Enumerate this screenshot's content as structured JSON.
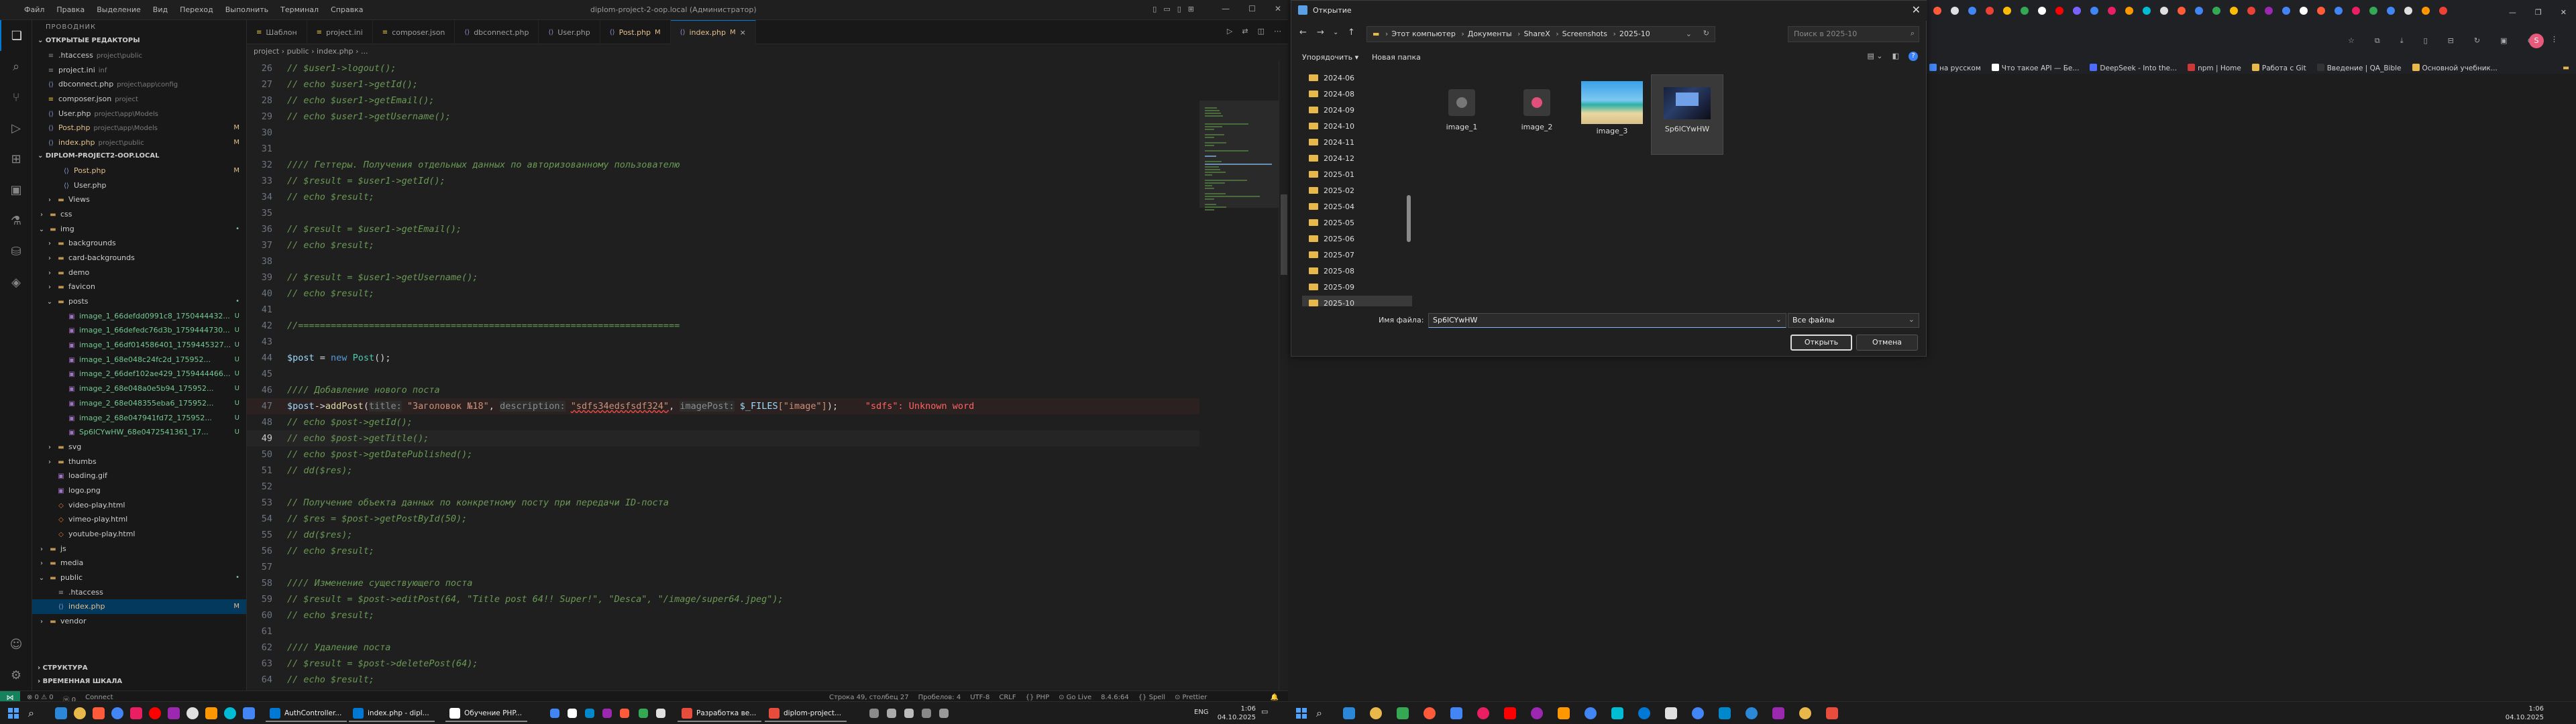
{
  "vscode": {
    "menu": [
      "Файл",
      "Правка",
      "Выделение",
      "Вид",
      "Переход",
      "Выполнить",
      "Терминал",
      "Справка"
    ],
    "title": "diplom-project-2-oop.local (Администратор)",
    "explorer_title": "ПРОВОДНИК",
    "open_editors_header": "ОТКРЫТЫЕ РЕДАКТОРЫ",
    "open_editors": [
      {
        "name": ".htaccess",
        "path": "project\\public",
        "status": ""
      },
      {
        "name": "project.ini",
        "path": "inf",
        "status": ""
      },
      {
        "name": "dbconnect.php",
        "path": "project\\app\\config",
        "status": ""
      },
      {
        "name": "composer.json",
        "path": "project",
        "status": ""
      },
      {
        "name": "User.php",
        "path": "project\\app\\Models",
        "status": ""
      },
      {
        "name": "Post.php",
        "path": "project\\app\\Models",
        "status": "M"
      },
      {
        "name": "index.php",
        "path": "project\\public",
        "status": "M"
      }
    ],
    "project_header": "DIPLOM-PROJECT2-OOP.LOCAL",
    "tree": [
      {
        "name": "Post.php",
        "status": "M"
      },
      {
        "name": "User.php",
        "status": ""
      },
      {
        "name": "Views",
        "status": ""
      },
      {
        "name": "css",
        "status": ""
      },
      {
        "name": "img",
        "status": "•"
      },
      {
        "name": "backgrounds",
        "status": ""
      },
      {
        "name": "card-backgrounds",
        "status": ""
      },
      {
        "name": "demo",
        "status": ""
      },
      {
        "name": "favicon",
        "status": ""
      },
      {
        "name": "posts",
        "status": "•"
      },
      {
        "name": "image_1_66defdd0991c8_1750444432...",
        "status": "U"
      },
      {
        "name": "image_1_66defedc76d3b_1759444730...",
        "status": "U"
      },
      {
        "name": "image_1_66df014586401_1759445327...",
        "status": "U"
      },
      {
        "name": "image_1_68e048c24fc2d_175952...",
        "status": "U"
      },
      {
        "name": "image_2_66def102ae429_1759444466...",
        "status": "U"
      },
      {
        "name": "image_2_68e048a0e5b94_175952...",
        "status": "U"
      },
      {
        "name": "image_2_68e048355eba6_175952...",
        "status": "U"
      },
      {
        "name": "image_2_68e047941fd72_175952...",
        "status": "U"
      },
      {
        "name": "Sp6lCYwHW_68e0472541361_17...",
        "status": "U"
      },
      {
        "name": "svg",
        "status": ""
      },
      {
        "name": "thumbs",
        "status": ""
      },
      {
        "name": "loading.gif",
        "status": ""
      },
      {
        "name": "logo.png",
        "status": ""
      },
      {
        "name": "video-play.html",
        "status": ""
      },
      {
        "name": "vimeo-play.html",
        "status": ""
      },
      {
        "name": "youtube-play.html",
        "status": ""
      },
      {
        "name": "js",
        "status": ""
      },
      {
        "name": "media",
        "status": ""
      },
      {
        "name": "public",
        "status": "•"
      },
      {
        "name": ".htaccess",
        "status": ""
      },
      {
        "name": "index.php",
        "status": "M"
      },
      {
        "name": "vendor",
        "status": ""
      }
    ],
    "outline_header": "СТРУКТУРА",
    "timeline_header": "ВРЕМЕННАЯ ШКАЛА",
    "tabs": [
      {
        "label": "Шаблон",
        "modified": ""
      },
      {
        "label": "project.ini",
        "modified": ""
      },
      {
        "label": "composer.json",
        "modified": ""
      },
      {
        "label": "dbconnect.php",
        "modified": ""
      },
      {
        "label": "User.php",
        "modified": ""
      },
      {
        "label": "Post.php",
        "modified": "M"
      },
      {
        "label": "index.php",
        "modified": "M"
      }
    ],
    "breadcrumb": "project › public › index.php › ...",
    "code_lines": [
      {
        "n": "26",
        "text": "// $user1->logout();"
      },
      {
        "n": "27",
        "text": "// echo $user1->getId();"
      },
      {
        "n": "28",
        "text": "// echo $user1->getEmail();"
      },
      {
        "n": "29",
        "text": "// echo $user1->getUsername();"
      },
      {
        "n": "30",
        "text": ""
      },
      {
        "n": "31",
        "text": ""
      },
      {
        "n": "32",
        "text": "//// Геттеры. Получения отдельных данных по авторизованному пользователю"
      },
      {
        "n": "33",
        "text": "// $result = $user1->getId();"
      },
      {
        "n": "34",
        "text": "// echo $result;"
      },
      {
        "n": "35",
        "text": ""
      },
      {
        "n": "36",
        "text": "// $result = $user1->getEmail();"
      },
      {
        "n": "37",
        "text": "// echo $result;"
      },
      {
        "n": "38",
        "text": ""
      },
      {
        "n": "39",
        "text": "// $result = $user1->getUsername();"
      },
      {
        "n": "40",
        "text": "// echo $result;"
      },
      {
        "n": "41",
        "text": ""
      },
      {
        "n": "42",
        "text": "//======================================================================"
      },
      {
        "n": "43",
        "text": ""
      },
      {
        "n": "44",
        "text": "$post = new Post();"
      },
      {
        "n": "45",
        "text": ""
      },
      {
        "n": "46",
        "text": "//// Добавление нового поста"
      },
      {
        "n": "47",
        "text": "$post->addPost(title: \"Заголовок №18\", description: \"sdfs34edsfsdf324\", imagePost: $_FILES[\"image\"]);     \"sdfs\": Unknown word"
      },
      {
        "n": "48",
        "text": "// echo $post->getId();"
      },
      {
        "n": "49",
        "text": "// echo $post->getTitle();"
      },
      {
        "n": "50",
        "text": "// echo $post->getDatePublished();"
      },
      {
        "n": "51",
        "text": "// dd($res);"
      },
      {
        "n": "52",
        "text": ""
      },
      {
        "n": "53",
        "text": "// Получение объекта данных по конкретному посту при передачи ID-поста"
      },
      {
        "n": "54",
        "text": "// $res = $post->getPostById(50);"
      },
      {
        "n": "55",
        "text": "// dd($res);"
      },
      {
        "n": "56",
        "text": "// echo $result;"
      },
      {
        "n": "57",
        "text": ""
      },
      {
        "n": "58",
        "text": "//// Изменение существующего поста"
      },
      {
        "n": "59",
        "text": "// $result = $post->editPost(64, \"Title post 64!! Super!\", \"Desca\", \"/image/super64.jpeg\");"
      },
      {
        "n": "60",
        "text": "// echo $result;"
      },
      {
        "n": "61",
        "text": ""
      },
      {
        "n": "62",
        "text": "//// Удаление поста"
      },
      {
        "n": "63",
        "text": "// $result = $post->deletePost(64);"
      },
      {
        "n": "64",
        "text": "// echo $result;"
      }
    ],
    "line47": {
      "prefix": "$post->addPost(",
      "hint1": "title:",
      "arg1": "\"Заголовок №18\"",
      "hint2": "description:",
      "arg2": "\"sdfs34edsfsdf324\"",
      "hint3": "imagePost:",
      "arg3a": "$_FILES",
      "arg3b": "[\"image\"]",
      "suffix": ");",
      "diag": "\"sdfs\": Unknown word"
    },
    "status_left": [
      "⊗ 0  ⚠ 0",
      "ⓦ 0",
      "Connect"
    ],
    "status_mid": [
      "Строка 49, столбец 27",
      "Пробелов: 4",
      "UTF-8",
      "CRLF",
      "{} PHP",
      "⊙ Go Live",
      "8.4.6:64",
      "{} Spell",
      "⊙ Prettier"
    ]
  },
  "dialog": {
    "title": "Открытие",
    "address": [
      "Этот компьютер",
      "Документы",
      "ShareX",
      "Screenshots",
      "2025-10"
    ],
    "search_placeholder": "Поиск в 2025-10",
    "organize": "Упорядочить ▾",
    "new_folder": "Новая папка",
    "folders": [
      "2024-06",
      "2024-08",
      "2024-09",
      "2024-10",
      "2024-11",
      "2024-12",
      "2025-01",
      "2025-02",
      "2025-04",
      "2025-05",
      "2025-06",
      "2025-07",
      "2025-08",
      "2025-09",
      "2025-10"
    ],
    "selected_folder": "2025-10",
    "files": [
      {
        "name": "image_1",
        "kind": "dark-icon"
      },
      {
        "name": "image_2",
        "kind": "red-icon"
      },
      {
        "name": "image_3",
        "kind": "beach"
      },
      {
        "name": "Sp6lCYwHW",
        "kind": "desk"
      }
    ],
    "filename_label": "Имя файла:",
    "filename_value": "Sp6lCYwHW",
    "filetype_value": "Все файлы",
    "open_button": "Открыть",
    "cancel_button": "Отмена"
  },
  "browser": {
    "bookmarks": [
      {
        "label": "на русском",
        "color": "#4285f4"
      },
      {
        "label": "Что такое API — Бе...",
        "color": "#ffffff"
      },
      {
        "label": "DeepSeek - Into the...",
        "color": "#4d6bfe"
      },
      {
        "label": "npm | Home",
        "color": "#cb3837"
      },
      {
        "label": "Работа с Git",
        "color": "#e8b84a"
      },
      {
        "label": "Введение | QA_Bible",
        "color": "#333333"
      },
      {
        "label": "Основной учебник...",
        "color": "#e8b84a"
      }
    ],
    "avatar": "S"
  },
  "taskbar1": {
    "apps": [
      {
        "label": "AuthController...",
        "color": "#0078d4"
      },
      {
        "label": "index.php - dipl...",
        "color": "#0078d4"
      },
      {
        "label": "Обучение PHP...",
        "color": "#ffffff"
      },
      {
        "label": "Разработка ве...",
        "color": "#e74c3c"
      },
      {
        "label": "diplom-project...",
        "color": "#e74c3c"
      }
    ],
    "lang": "ENG",
    "time": "1:06",
    "date": "04.10.2025"
  },
  "taskbar2": {
    "time": "1:06",
    "date": "04.10.2025"
  }
}
